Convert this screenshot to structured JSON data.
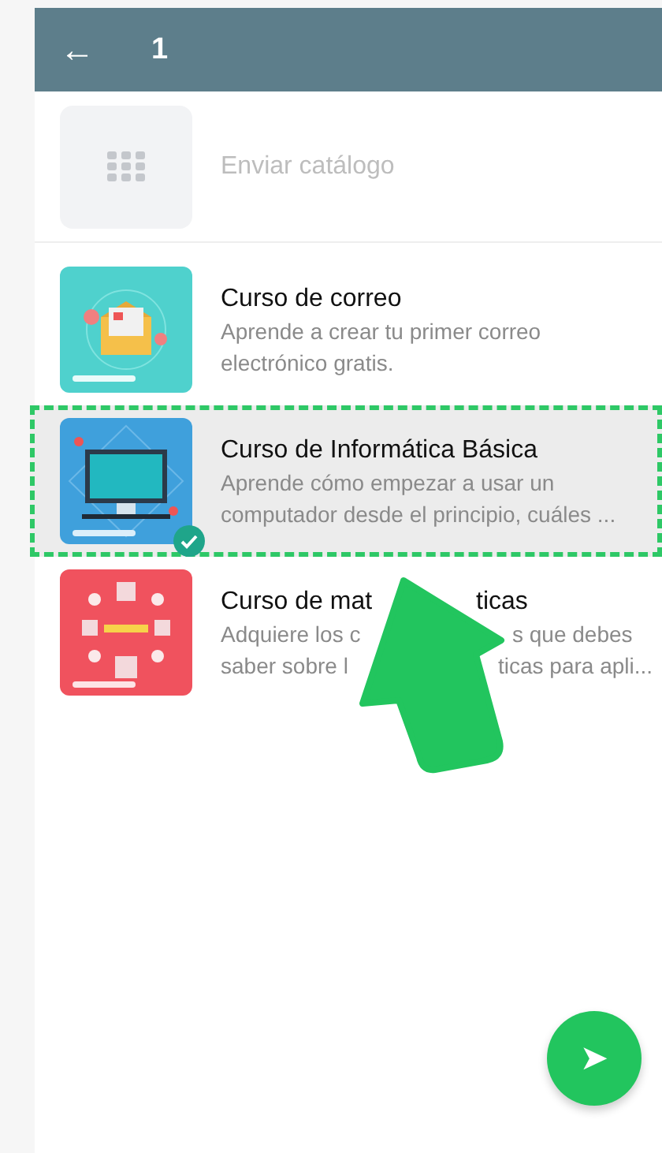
{
  "header": {
    "back_icon": "←",
    "title": "1"
  },
  "send_catalog": {
    "label": "Enviar catálogo"
  },
  "items": [
    {
      "title": [
        "Curso de correo"
      ],
      "description": [
        [
          "Aprende a crear tu primer correo"
        ],
        [
          "electrónico gratis."
        ]
      ],
      "selected": false
    },
    {
      "title": [
        "Curso de Informática Básica"
      ],
      "description": [
        [
          "Aprende cómo empezar a usar un"
        ],
        [
          "computador desde el principio, cuáles ..."
        ]
      ],
      "selected": true
    },
    {
      "title": [
        "Curso de mat",
        "ticas"
      ],
      "description": [
        [
          "Adquiere los c",
          "s que debes"
        ],
        [
          "saber sobre l",
          "ticas para apli..."
        ]
      ],
      "selected": false
    }
  ],
  "send_button": {
    "icon": "➤"
  }
}
